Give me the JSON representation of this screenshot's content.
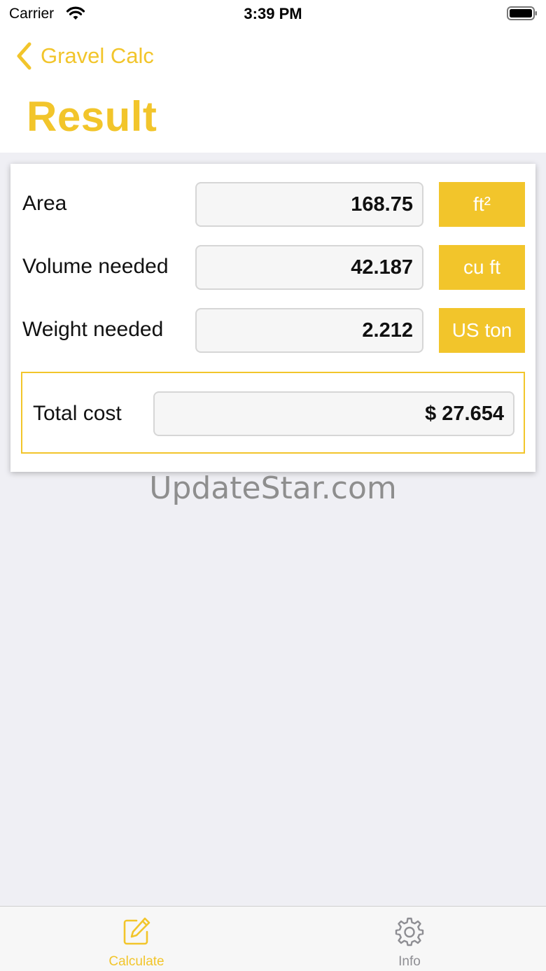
{
  "status_bar": {
    "carrier": "Carrier",
    "time": "3:39 PM"
  },
  "nav": {
    "back_label": "Gravel Calc",
    "title": "Result"
  },
  "results": [
    {
      "label": "Area",
      "value": "168.75",
      "unit": "ft²"
    },
    {
      "label": "Volume needed",
      "value": "42.187",
      "unit": "cu ft"
    },
    {
      "label": "Weight needed",
      "value": "2.212",
      "unit": "US ton"
    }
  ],
  "total": {
    "label": "Total cost",
    "value": "$ 27.654"
  },
  "watermark": "UpdateStar.com",
  "tabs": [
    {
      "label": "Calculate",
      "icon": "edit-icon",
      "active": true
    },
    {
      "label": "Info",
      "icon": "gear-icon",
      "active": false
    }
  ],
  "colors": {
    "accent": "#f2c52b",
    "background": "#efeff4",
    "inactive_tab": "#8e8e93"
  }
}
